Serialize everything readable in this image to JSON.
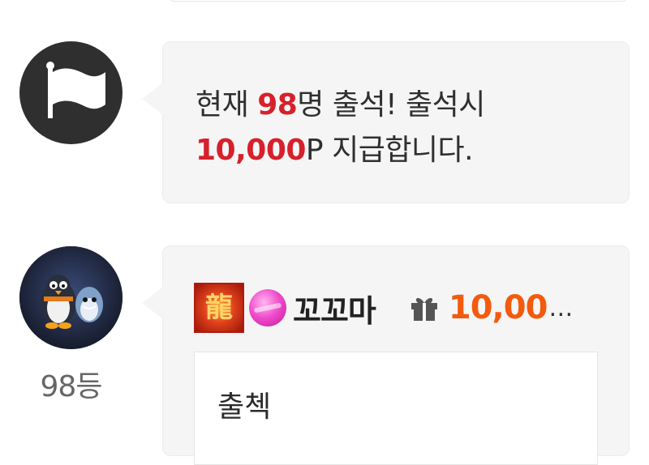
{
  "notice": {
    "icon": "flag-icon",
    "line1_prefix": "현재 ",
    "count": "98",
    "line1_suffix": "명 출석! 출석시",
    "amount": "10,000",
    "line2_suffix": "P 지급합니다."
  },
  "chat": {
    "avatar_icon": "penguin-avatar",
    "rank": "98등",
    "nickname": "꼬꼬마",
    "gift_amount": "10,00",
    "gift_ellipsis": "…",
    "message": "출첵"
  },
  "colors": {
    "highlight_red": "#d6212c",
    "gift_orange": "#f35a0e",
    "bubble_bg": "#f5f5f5"
  }
}
